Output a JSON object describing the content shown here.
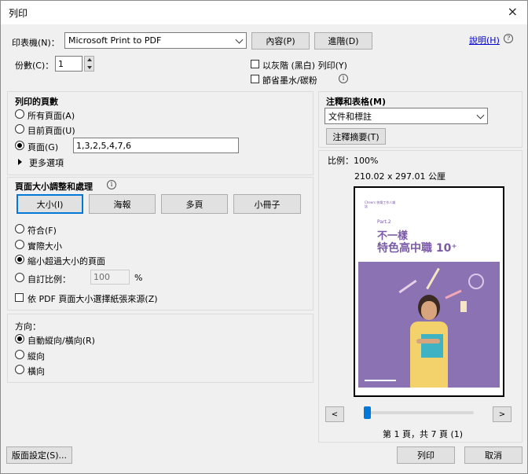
{
  "window": {
    "title": "列印",
    "close_glyph": "×"
  },
  "printer": {
    "label": "印表機(N)：",
    "value": "Microsoft Print to PDF",
    "properties_button": "內容(P)",
    "advanced_button": "進階(D)",
    "help_link": "說明(H)"
  },
  "copies": {
    "label": "份數(C)：",
    "value": "1",
    "grayscale_label": "以灰階 (黑白) 列印(Y)",
    "save_ink_label": "節省墨水/碳粉"
  },
  "pages_to_print": {
    "heading": "列印的頁數",
    "options": [
      {
        "label": "所有頁面(A)",
        "selected": false
      },
      {
        "label": "目前頁面(U)",
        "selected": false
      },
      {
        "label": "頁面(G)",
        "selected": true
      }
    ],
    "pages_value": "1,3,2,5,4,7,6",
    "more_options": "更多選項"
  },
  "page_sizing": {
    "heading": "頁面大小調整和處理",
    "tabs": [
      "大小(I)",
      "海報",
      "多頁",
      "小冊子"
    ],
    "options": [
      {
        "label": "符合(F)",
        "selected": false
      },
      {
        "label": "實際大小",
        "selected": false
      },
      {
        "label": "縮小超過大小的頁面",
        "selected": true
      },
      {
        "label": "自訂比例：",
        "selected": false
      }
    ],
    "custom_scale_value": "100",
    "percent": "%",
    "paper_source_label": "依 PDF 頁面大小選擇紙張來源(Z)"
  },
  "orientation": {
    "heading": "方向：",
    "options": [
      {
        "label": "自動縱向/橫向(R)",
        "selected": true
      },
      {
        "label": "縱向",
        "selected": false
      },
      {
        "label": "橫向",
        "selected": false
      }
    ]
  },
  "comments": {
    "heading": "注釋和表格(M)",
    "value": "文件和標註",
    "summarize_button": "注釋摘要(T)"
  },
  "preview": {
    "scale": "比例：100%",
    "dimensions": "210.02 x 297.01 公厘",
    "page_status": "第 1 頁，共 7 頁 (1)",
    "prev_glyph": "<",
    "next_glyph": ">",
    "slider_position": 1,
    "cover": {
      "brand": "Cheers 快樂工作人雜誌",
      "part": "Part.2",
      "title_line1": "不一樣",
      "title_line2": "特色高中職 10⁺"
    }
  },
  "footer": {
    "page_setup_button": "版面設定(S)...",
    "print_button": "列印",
    "cancel_button": "取消"
  },
  "colors": {
    "accent": "#0078d7",
    "cover_purple": "#8b72b3",
    "link": "#0000cc"
  }
}
